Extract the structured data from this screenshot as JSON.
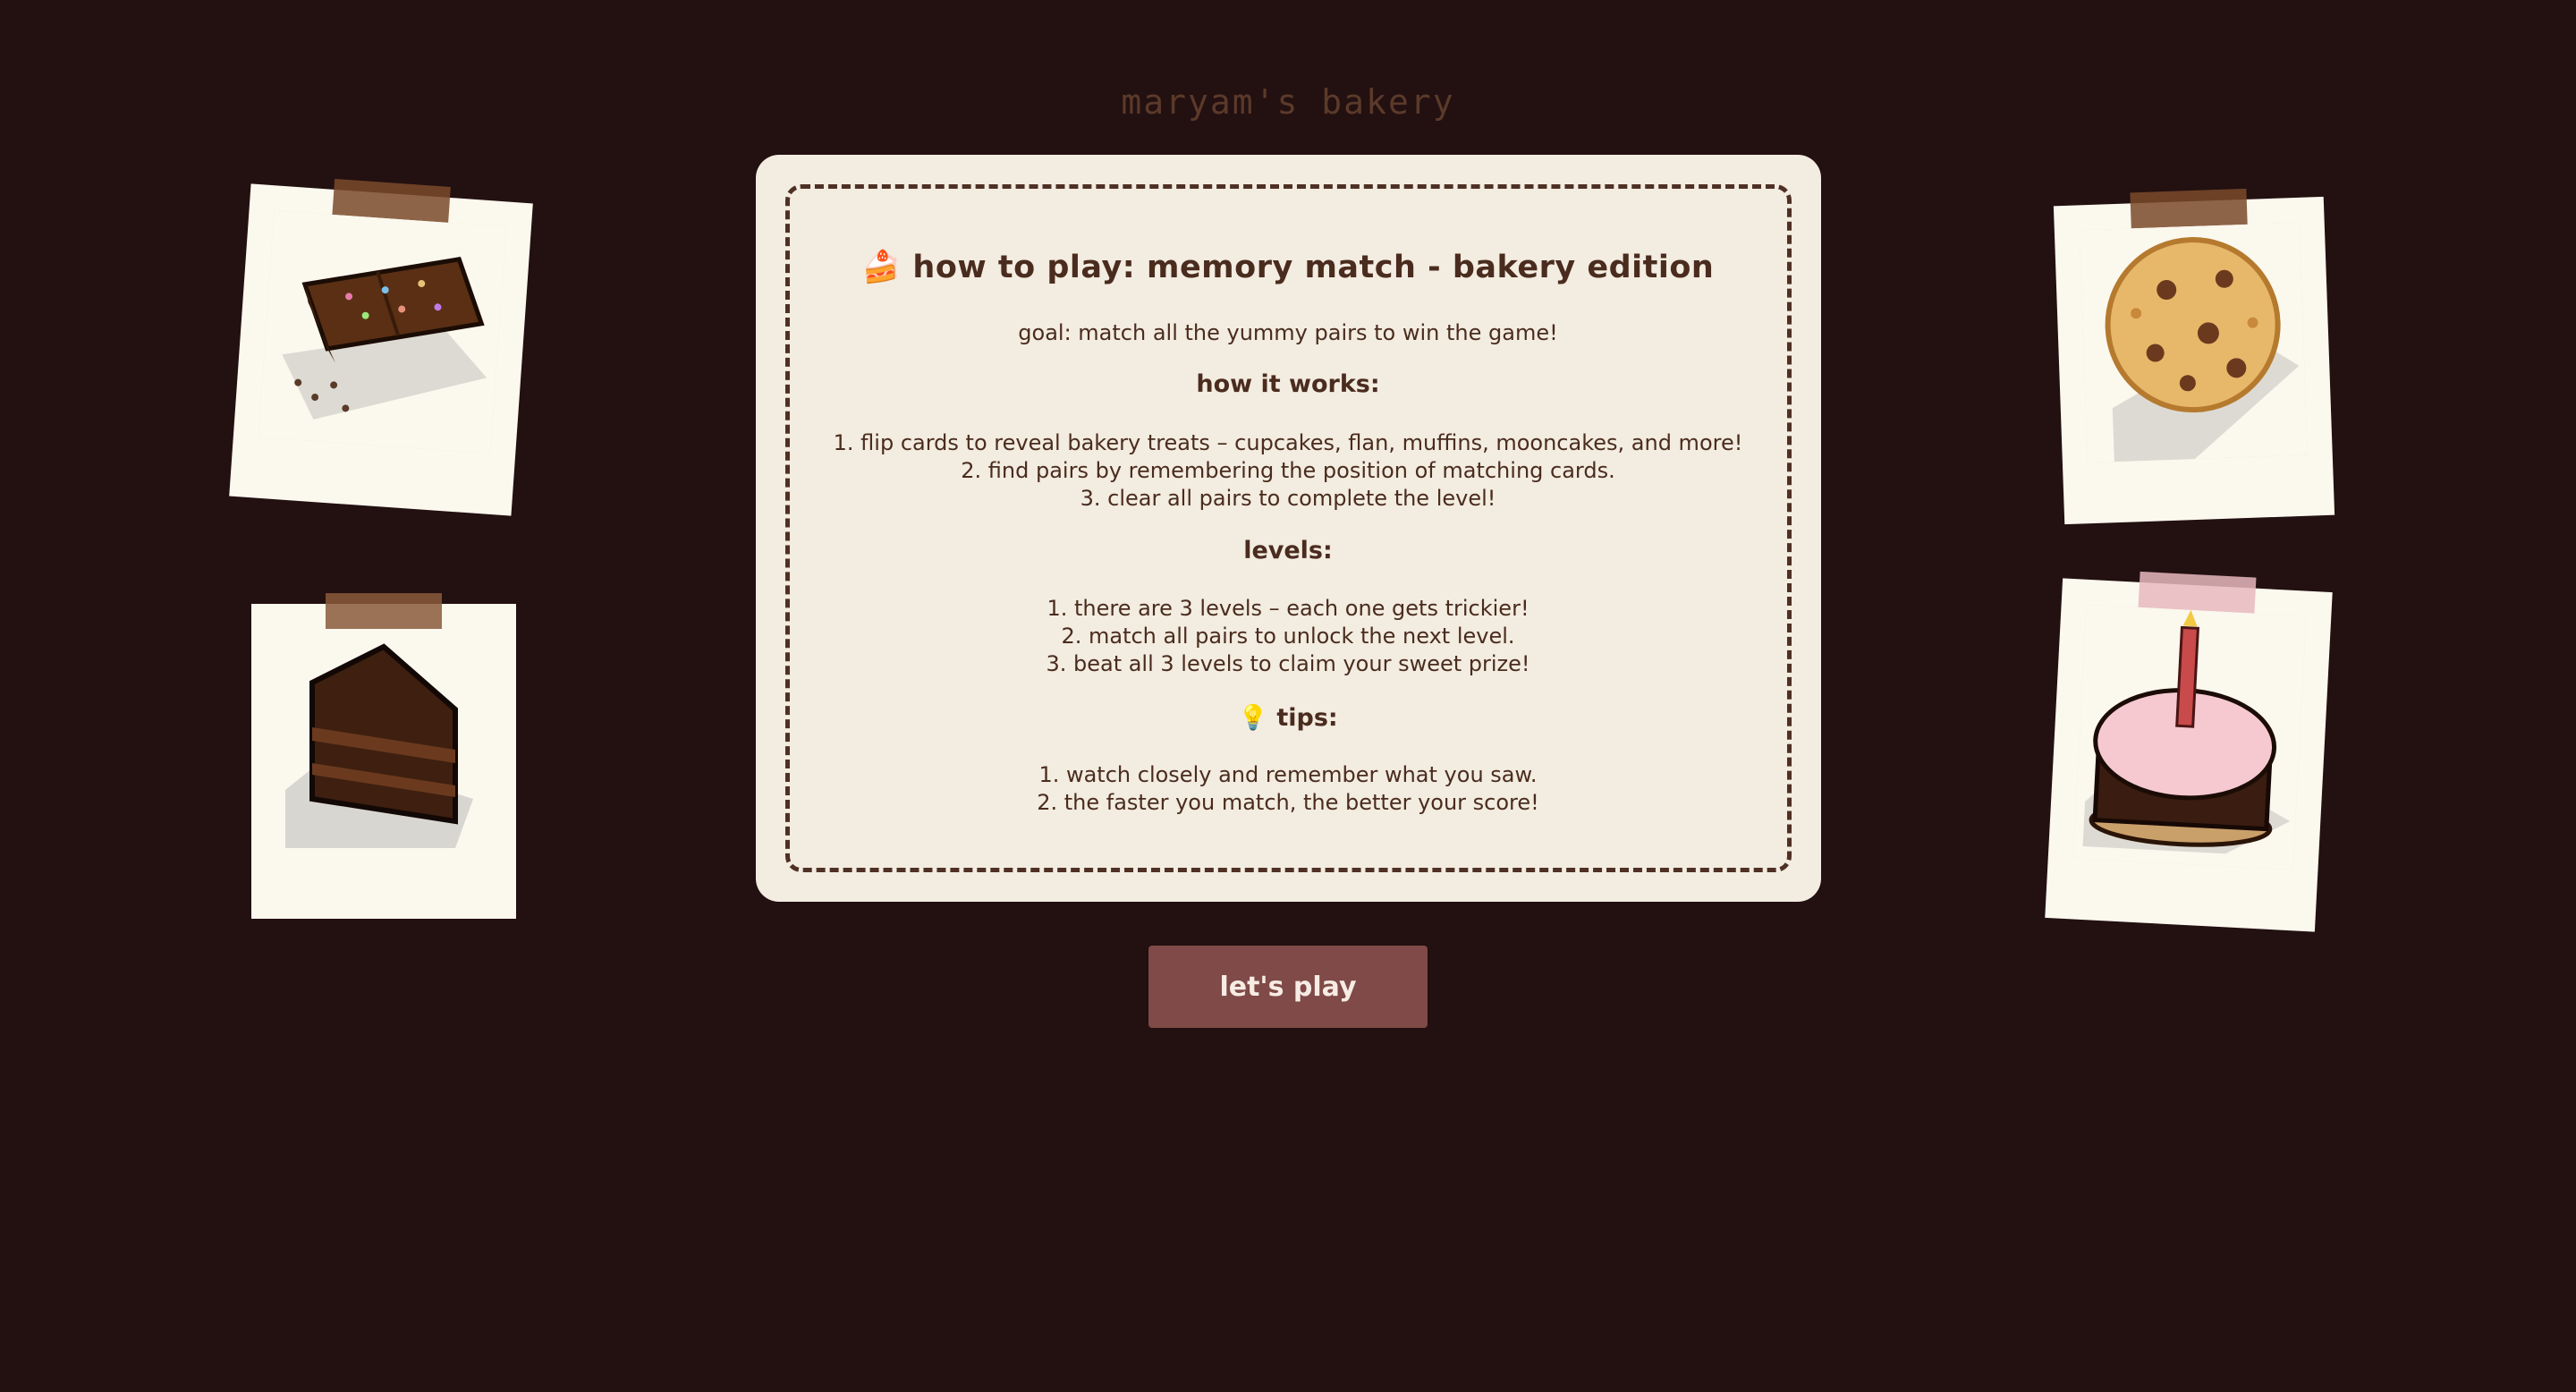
{
  "site": {
    "title": "maryam's bakery"
  },
  "instructions": {
    "heading": "🍰 how to play: memory match - bakery edition",
    "goal": "goal: match all the yummy pairs to win the game!",
    "how_it_works_title": "how it works:",
    "how_it_works": [
      "1. flip cards to reveal bakery treats – cupcakes, flan, muffins, mooncakes, and more!",
      "2. find pairs by remembering the position of matching cards.",
      "3. clear all pairs to complete the level!"
    ],
    "levels_title": "levels:",
    "levels": [
      "1. there are 3 levels – each one gets trickier!",
      "2. match all pairs to unlock the next level.",
      "3. beat all 3 levels to claim your sweet prize!"
    ],
    "tips_title": "💡 tips:",
    "tips": [
      "1. watch closely and remember what you saw.",
      "2. the faster you match, the better your score!"
    ]
  },
  "actions": {
    "play_label": "let's play"
  },
  "photos": [
    {
      "name": "brownie",
      "icon": "brownie-icon"
    },
    {
      "name": "chocolate-cake-slice",
      "icon": "cake-slice-icon"
    },
    {
      "name": "cookie",
      "icon": "cookie-icon"
    },
    {
      "name": "birthday-cake",
      "icon": "birthday-cake-icon"
    }
  ],
  "colors": {
    "background": "#231011",
    "card": "#f3ece0",
    "text": "#4a2c1f",
    "button": "#7f4a47"
  }
}
